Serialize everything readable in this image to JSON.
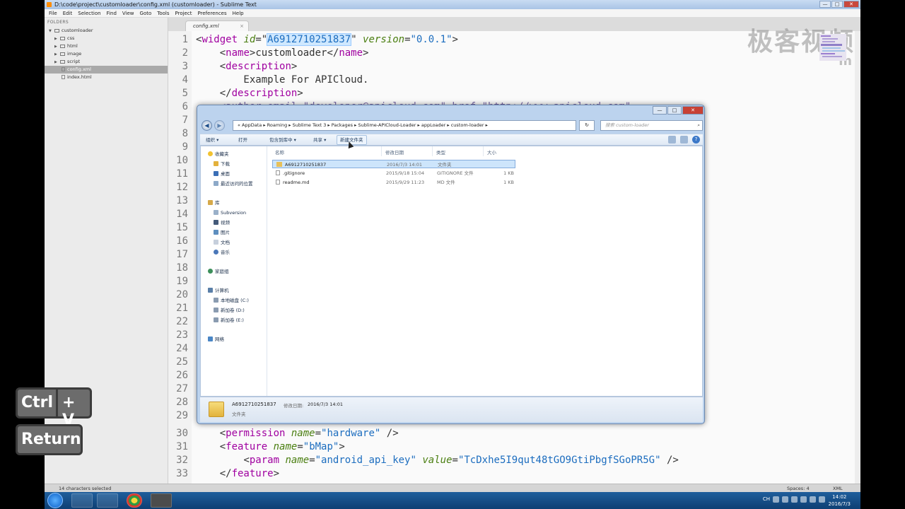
{
  "sublime": {
    "title": "D:\\code\\project\\customloader\\config.xml (customloader) - Sublime Text",
    "menu": [
      "File",
      "Edit",
      "Selection",
      "Find",
      "View",
      "Goto",
      "Tools",
      "Project",
      "Preferences",
      "Help"
    ],
    "sidebar": {
      "header": "FOLDERS",
      "root": "customloader",
      "items": [
        {
          "label": "css",
          "type": "folder"
        },
        {
          "label": "html",
          "type": "folder"
        },
        {
          "label": "image",
          "type": "folder"
        },
        {
          "label": "script",
          "type": "folder"
        },
        {
          "label": "config.xml",
          "type": "file"
        },
        {
          "label": "index.html",
          "type": "file"
        }
      ]
    },
    "tab": {
      "label": "config.xml",
      "close": "×"
    },
    "status": {
      "left": "14 characters selected",
      "spaces": "Spaces: 4",
      "syntax": "XML"
    },
    "watermark": "极客视频",
    "watermark_sub": "m"
  },
  "code": {
    "line_numbers": [
      "1",
      "2",
      "3",
      "4",
      "5",
      "6",
      "7",
      "8",
      "9",
      "10",
      "11",
      "12",
      "13",
      "14",
      "15",
      "16",
      "17",
      "18",
      "19",
      "20",
      "21",
      "22",
      "23",
      "24",
      "25",
      "26",
      "27",
      "28",
      "29",
      "30",
      "31",
      "32",
      "33"
    ],
    "l1": {
      "open": "<",
      "tag": "widget",
      "a1": " id",
      "eq1": "=\"",
      "v1": "A6912710251837",
      "q1": "\"",
      "a2": " version",
      "eq2": "=",
      "v2": "\"0.0.1\"",
      "close": ">"
    },
    "l2": {
      "indent": "    ",
      "open": "<",
      "tag": "name",
      "gt": ">",
      "text": "customloader",
      "end": "</",
      "tag2": "name",
      "gt2": ">"
    },
    "l3": {
      "indent": "    ",
      "open": "<",
      "tag": "description",
      "gt": ">"
    },
    "l4": {
      "text": "        Example For APICloud."
    },
    "l5": {
      "indent": "    ",
      "end": "</",
      "tag": "description",
      "gt": ">"
    },
    "l6": {
      "text": "    <author email=\"developer@apicloud.com\" href=\"http://www.apicloud.com\""
    },
    "l30": {
      "indent": "    ",
      "open": "<",
      "tag": "permission",
      "a1": " name",
      "eq": "=",
      "v1": "\"hardware\"",
      "close": " />"
    },
    "l31": {
      "indent": "    ",
      "open": "<",
      "tag": "feature",
      "a1": " name",
      "eq": "=",
      "v1": "\"bMap\"",
      "close": ">"
    },
    "l32": {
      "indent": "        ",
      "open": "<",
      "tag": "param",
      "a1": " name",
      "eq1": "=",
      "v1": "\"android_api_key\"",
      "a2": " value",
      "eq2": "=",
      "v2": "\"TcDxhe5I9qut48tGO9GtiPbgfSGoPR5G\"",
      "close": " />"
    },
    "l33": {
      "indent": "    ",
      "end": "</",
      "tag": "feature",
      "gt": ">"
    }
  },
  "explorer": {
    "window_buttons": [
      "—",
      "□",
      "✕"
    ],
    "back": "◀",
    "forward": "▶",
    "address": "«  AppData  ▸  Roaming  ▸  Sublime Text 3  ▸  Packages  ▸  Sublime-APICloud-Loader  ▸  appLoader  ▸  custom-loader  ▸",
    "refresh": "↻",
    "search_placeholder": "搜索 custom-loader",
    "search_icon": "⌕",
    "toolbar": [
      "组织 ▾",
      "打开",
      "包含到库中 ▾",
      "共享 ▾",
      "新建文件夹"
    ],
    "help": "?",
    "nav": {
      "favorites": "收藏夹",
      "downloads": "下载",
      "desktop": "桌面",
      "recent": "最近访问的位置",
      "libraries": "库",
      "subversion": "Subversion",
      "videos": "视频",
      "pictures": "图片",
      "documents": "文档",
      "music": "音乐",
      "homegroup": "家庭组",
      "computer": "计算机",
      "drive_c": "本地磁盘 (C:)",
      "drive_d": "新加卷 (D:)",
      "drive_e": "新加卷 (E:)",
      "network": "网络"
    },
    "columns": [
      "名称",
      "修改日期",
      "类型",
      "大小"
    ],
    "files": [
      {
        "name": "A6912710251837",
        "date": "2016/7/3 14:01",
        "type": "文件夹",
        "size": ""
      },
      {
        "name": ".gitignore",
        "date": "2015/9/18 15:04",
        "type": "GITIGNORE 文件",
        "size": "1 KB"
      },
      {
        "name": "readme.md",
        "date": "2015/9/29 11:23",
        "type": "MD 文件",
        "size": "1 KB"
      }
    ],
    "detail": {
      "name": "A6912710251837",
      "date_label": "修改日期:",
      "date": "2016/7/3 14:01",
      "type": "文件夹"
    }
  },
  "overlay": {
    "ctrl": "Ctrl",
    "plus_v": "+ V",
    "return": "Return"
  },
  "taskbar": {
    "time": "14:02",
    "date": "2016/7/3",
    "lang": "CH"
  },
  "colors": {
    "tag": "#a000a0",
    "attr": "#4a7e10",
    "string": "#1c6dbf",
    "selection": "#cde5fb"
  }
}
